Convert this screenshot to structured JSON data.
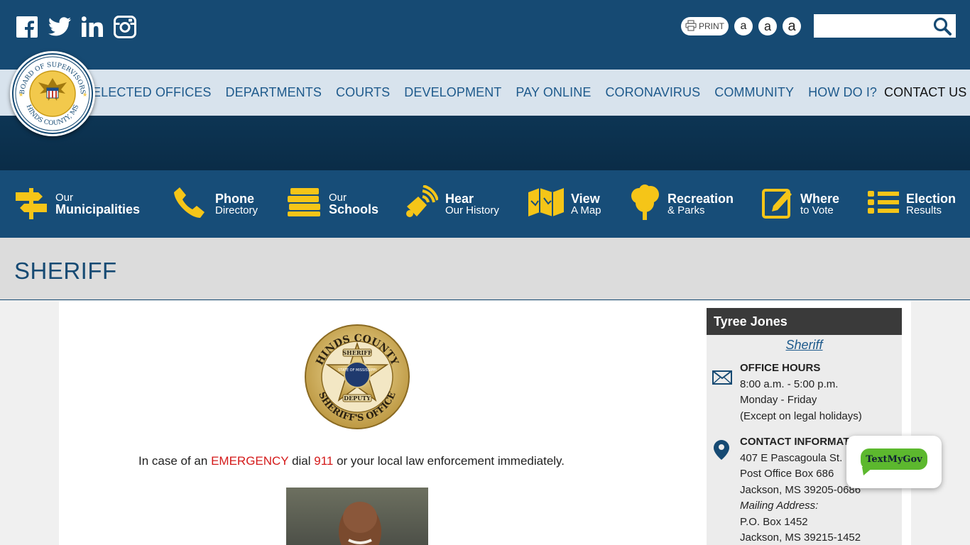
{
  "header": {
    "social": [
      "facebook-icon",
      "twitter-icon",
      "linkedin-icon",
      "instagram-icon"
    ],
    "print_label": "PRINT",
    "font_sizes": [
      "a",
      "a",
      "a"
    ],
    "search_placeholder": ""
  },
  "seal": {
    "text_top": "BOARD OF SUPERVISORS",
    "text_bottom": "HINDS COUNTY, MS"
  },
  "nav": {
    "items": [
      {
        "label": "ELECTED OFFICES"
      },
      {
        "label": "DEPARTMENTS"
      },
      {
        "label": "COURTS"
      },
      {
        "label": "DEVELOPMENT"
      },
      {
        "label": "PAY ONLINE"
      },
      {
        "label": "CORONAVIRUS"
      },
      {
        "label": "COMMUNITY"
      },
      {
        "label": "HOW DO I?"
      },
      {
        "label": "CONTACT US"
      }
    ]
  },
  "quick_links": [
    {
      "line1": "Our",
      "line2": "Municipalities",
      "icon": "signpost-icon"
    },
    {
      "line1": "Phone",
      "line2": "Directory",
      "icon": "phone-icon"
    },
    {
      "line1": "Our",
      "line2": "Schools",
      "icon": "books-icon"
    },
    {
      "line1": "Hear",
      "line2": "Our History",
      "icon": "megaphone-icon"
    },
    {
      "line1": "View",
      "line2": "A Map",
      "icon": "map-icon"
    },
    {
      "line1": "Recreation",
      "line2": "& Parks",
      "icon": "tree-icon"
    },
    {
      "line1": "Where",
      "line2": "to Vote",
      "icon": "edit-icon"
    },
    {
      "line1": "Election",
      "line2": "Results",
      "icon": "list-icon"
    }
  ],
  "page": {
    "title": "SHERIFF"
  },
  "badge": {
    "top": "HINDS COUNTY",
    "bottom": "SHERIFF'S OFFICE",
    "ribbon_top": "SHERIFF",
    "ribbon_bottom": "DEPUTY",
    "inner": "STATE OF MISSISSIPPI"
  },
  "emergency": {
    "pre": "In case of an ",
    "word": "EMERGENCY",
    "mid": " dial ",
    "number": "911",
    "post": " or your local law enforcement immediately."
  },
  "sidebar": {
    "name": "Tyree Jones",
    "title": "Sheriff",
    "hours_head": "OFFICE HOURS",
    "hours": [
      "8:00 a.m. - 5:00 p.m.",
      "Monday - Friday",
      "(Except on legal holidays)"
    ],
    "contact_head": "CONTACT INFORMATION",
    "address": [
      "407 E Pascagoula St.",
      "Post Office Box 686",
      "Jackson, MS 39205-0686"
    ],
    "mailing_label": "Mailing Address:",
    "mailing": [
      "P.O. Box 1452",
      "Jackson, MS 39215-1452"
    ]
  },
  "widget": {
    "label": "TextMyGov"
  },
  "colors": {
    "brand_blue": "#164a73",
    "nav_bg": "#d8e3ed",
    "accent_yellow": "#f5c518",
    "emergency_red": "#d41a1a"
  }
}
